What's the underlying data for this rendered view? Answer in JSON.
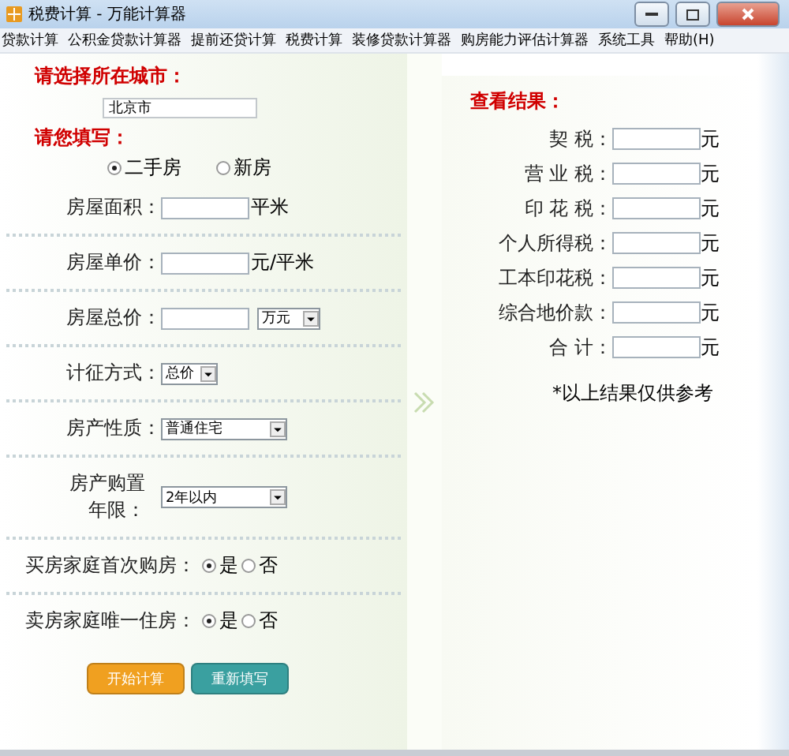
{
  "window": {
    "title": "税费计算 - 万能计算器"
  },
  "menu": [
    "贷款计算",
    "公积金贷款计算器",
    "提前还贷计算",
    "税费计算",
    "装修贷款计算器",
    "购房能力评估计算器",
    "系统工具",
    "帮助(H)"
  ],
  "city": {
    "heading": "请选择所在城市：",
    "value": "北京市"
  },
  "form": {
    "heading": "请您填写：",
    "house_type": [
      {
        "label": "二手房",
        "selected": true
      },
      {
        "label": "新房",
        "selected": false
      }
    ],
    "rows": [
      {
        "kind": "input",
        "label": "房屋面积：",
        "unit": "平米"
      },
      {
        "kind": "input",
        "label": "房屋单价：",
        "unit": "元/平米"
      },
      {
        "kind": "input_select",
        "label": "房屋总价：",
        "select": "万元"
      },
      {
        "kind": "short_select",
        "label": "计征方式：",
        "select": "总价"
      },
      {
        "kind": "select",
        "label": "房产性质：",
        "select": "普通住宅"
      },
      {
        "kind": "select",
        "label": "房产购置年限：",
        "select": "2年以内"
      },
      {
        "kind": "radio",
        "label": "买房家庭首次购房：",
        "options": [
          {
            "label": "是",
            "selected": true
          },
          {
            "label": "否",
            "selected": false
          }
        ]
      },
      {
        "kind": "radio",
        "label": "卖房家庭唯一住房：",
        "options": [
          {
            "label": "是",
            "selected": true
          },
          {
            "label": "否",
            "selected": false
          }
        ]
      }
    ],
    "buttons": [
      {
        "label": "开始计算",
        "color": "#f0a020"
      },
      {
        "label": "重新填写",
        "color": "#3aa0a0"
      }
    ]
  },
  "results": {
    "heading": "查看结果：",
    "rows": [
      {
        "label": "契 税：",
        "unit": "元"
      },
      {
        "label": "营 业 税：",
        "unit": "元"
      },
      {
        "label": "印 花 税：",
        "unit": "元"
      },
      {
        "label": "个人所得税：",
        "unit": "元"
      },
      {
        "label": "工本印花税：",
        "unit": "元"
      },
      {
        "label": "综合地价款：",
        "unit": "元"
      },
      {
        "label": "合 计：",
        "unit": "元"
      }
    ],
    "note": "*以上结果仅供参考"
  }
}
